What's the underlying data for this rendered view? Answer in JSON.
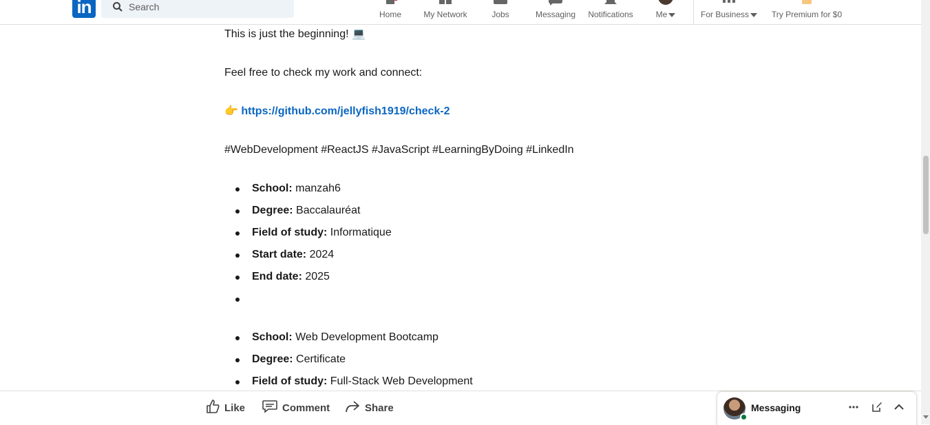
{
  "nav": {
    "search_placeholder": "Search",
    "items": [
      {
        "label": "Home",
        "icon": "home-icon"
      },
      {
        "label": "My Network",
        "icon": "network-icon"
      },
      {
        "label": "Jobs",
        "icon": "briefcase-icon"
      },
      {
        "label": "Messaging",
        "icon": "messaging-icon"
      },
      {
        "label": "Notifications",
        "icon": "bell-icon"
      },
      {
        "label": "Me",
        "icon": "avatar"
      },
      {
        "label": "For Business",
        "icon": "grid-icon"
      },
      {
        "label": "Try Premium for $0",
        "icon": "premium-icon"
      }
    ],
    "logo_text": "in"
  },
  "post": {
    "line1": "This is just the beginning! 💻",
    "line2": "Feel free to check my work and connect:",
    "link_emoji": "👉",
    "link": "https://github.com/jellyfish1919/check-2",
    "hashtags": "#WebDevelopment #ReactJS #JavaScript #LearningByDoing #LinkedIn",
    "education1": [
      {
        "label": "School:",
        "value": " manzah6"
      },
      {
        "label": "Degree:",
        "value": " Baccalauréat"
      },
      {
        "label": "Field of study:",
        "value": " Informatique"
      },
      {
        "label": "Start date:",
        "value": " 2024"
      },
      {
        "label": "End date:",
        "value": " 2025"
      },
      {
        "label": "",
        "value": ""
      }
    ],
    "education2": [
      {
        "label": "School:",
        "value": " Web Development Bootcamp"
      },
      {
        "label": "Degree:",
        "value": " Certificate"
      },
      {
        "label": "Field of study:",
        "value": " Full-Stack Web Development"
      }
    ]
  },
  "actions": {
    "like": "Like",
    "comment": "Comment",
    "share": "Share"
  },
  "messaging": {
    "title": "Messaging"
  },
  "colors": {
    "brand": "#0a66c2",
    "online": "#057642"
  }
}
